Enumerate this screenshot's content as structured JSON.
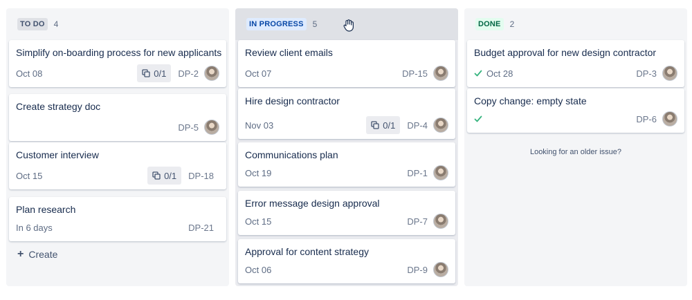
{
  "columns": {
    "todo": {
      "name": "TO DO",
      "count": "4",
      "cards": [
        {
          "title": "Simplify on-boarding process for new applicants",
          "date": "Oct 08",
          "subtasks": "0/1",
          "key": "DP-2"
        },
        {
          "title": "Create strategy doc",
          "date": "",
          "key": "DP-5"
        },
        {
          "title": "Customer interview",
          "date": "Oct 15",
          "subtasks": "0/1",
          "key": "DP-18"
        },
        {
          "title": "Plan research",
          "date": "In 6 days",
          "key": "DP-21"
        }
      ],
      "create_label": "Create"
    },
    "in_progress": {
      "name": "IN PROGRESS",
      "count": "5",
      "cards": [
        {
          "title": "Review client emails",
          "date": "Oct 07",
          "key": "DP-15"
        },
        {
          "title": "Hire design contractor",
          "date": "Nov 03",
          "subtasks": "0/1",
          "key": "DP-4"
        },
        {
          "title": "Communications plan",
          "date": "Oct 19",
          "key": "DP-1"
        },
        {
          "title": "Error message design approval",
          "date": "Oct 15",
          "key": "DP-7"
        },
        {
          "title": "Approval for content strategy",
          "date": "Oct 06",
          "key": "DP-9"
        }
      ]
    },
    "done": {
      "name": "DONE",
      "count": "2",
      "cards": [
        {
          "title": "Budget approval for new design contractor",
          "date": "Oct 28",
          "key": "DP-3"
        },
        {
          "title": "Copy change: empty state",
          "date": "",
          "key": "DP-6"
        }
      ],
      "older_label": "Looking for an older issue?"
    }
  },
  "colors": {
    "check": "#36b37e",
    "column_bg": "#f4f5f7",
    "progress_lozenge": "#0747a6",
    "done_lozenge": "#006644"
  },
  "icons": {
    "subtask": "subtask-icon",
    "check": "check-icon",
    "cursor": "hand-grab-icon",
    "create": "plus-icon"
  }
}
